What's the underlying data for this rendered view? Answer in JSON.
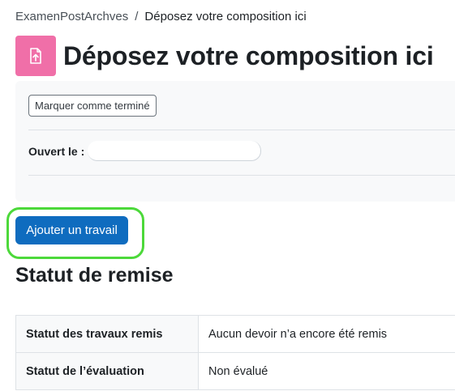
{
  "breadcrumb": {
    "course": "ExamenPostArchves",
    "separator": "/",
    "current": "Déposez votre composition ici"
  },
  "page": {
    "title": "Déposez votre composition ici",
    "icon": "file-upload-icon",
    "icon_color": "#f06fa8"
  },
  "info": {
    "complete_button": "Marquer comme terminé",
    "opened_label": "Ouvert le :",
    "opened_value": ""
  },
  "actions": {
    "add_submission": "Ajouter un travail",
    "primary_color": "#0f6cbf",
    "highlight_color": "#4cd93a"
  },
  "submission_status": {
    "heading": "Statut de remise",
    "rows": [
      {
        "label": "Statut des travaux remis",
        "value": "Aucun devoir n’a encore été remis"
      },
      {
        "label": "Statut de l’évaluation",
        "value": "Non évalué"
      }
    ]
  }
}
